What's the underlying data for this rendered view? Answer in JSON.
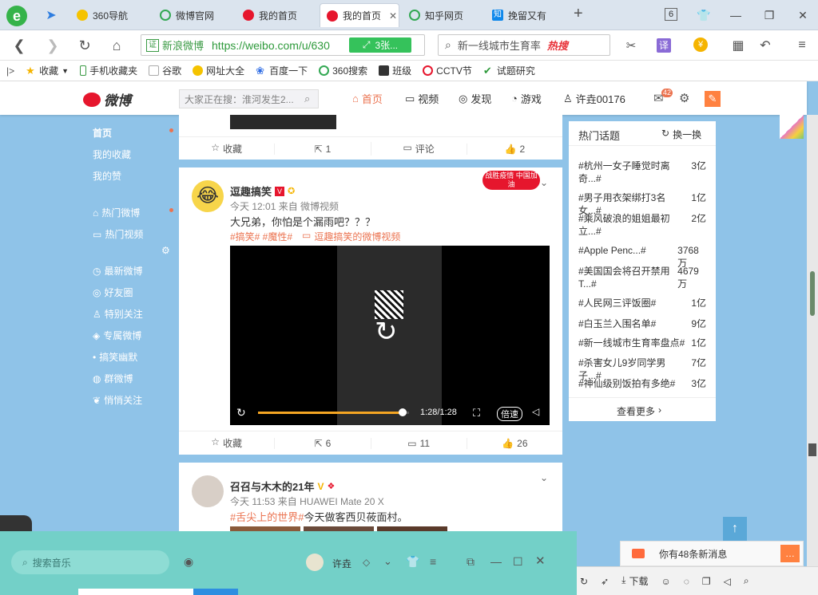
{
  "tabs": [
    {
      "label": "360导航",
      "icon": "plus-green-icon",
      "color": "#f5c300"
    },
    {
      "label": "微博官网",
      "icon": "circle-search-icon",
      "color": "#33a853"
    },
    {
      "label": "我的首页",
      "icon": "weibo-icon",
      "color": "#e6162d"
    },
    {
      "label": "我的首页",
      "icon": "weibo-icon",
      "color": "#e6162d"
    },
    {
      "label": "知乎网页",
      "icon": "circle-search-icon",
      "color": "#33a853"
    },
    {
      "label": "挽留又有",
      "icon": "zhihu-icon",
      "color": "#0f88eb"
    }
  ],
  "tab_count": "6",
  "active_tab_close": "✕",
  "new_tab": "+",
  "nav": {
    "secure_label": "新浪微博",
    "url": "https://weibo.com/u/630",
    "extension_label": "3张...",
    "search_text": "新一线城市生育率",
    "search_hot": "热搜",
    "translate": "译"
  },
  "bookmarks": [
    "收藏",
    "手机收藏夹",
    "谷歌",
    "网址大全",
    "百度一下",
    "360搜索",
    "班级",
    "CCTV节",
    "试题研究"
  ],
  "weibo": {
    "logo": "微博",
    "search_placeholder": "大家正在搜：淮河发生2...",
    "nav": [
      "首页",
      "视频",
      "发现",
      "游戏",
      "许垚00176"
    ],
    "mail_badge": "42"
  },
  "sidebar": {
    "items": [
      "首页",
      "我的收藏",
      "我的赞",
      "热门微博",
      "热门视频",
      "最新微博",
      "好友圈",
      "特别关注",
      "专属微博",
      "搞笑幽默",
      "群微博",
      "悄悄关注"
    ]
  },
  "card1": {
    "actions": [
      "收藏",
      "1",
      "评论",
      "2"
    ]
  },
  "card2": {
    "name": "逗趣搞笑",
    "badge": "战胜疫情 中国加油",
    "meta": "今天 12:01 来自 微博视频",
    "text": "大兄弟，你怕是个漏雨吧？？？",
    "tags": "#搞笑# #魔性#",
    "link": "逗趣搞笑的微博视频",
    "time": "1:28/1:28",
    "speed": "倍速",
    "actions": [
      "收藏",
      "6",
      "11",
      "26"
    ],
    "progress": 0.96
  },
  "card3": {
    "name": "召召与木木的21年",
    "meta": "今天 11:53 来自 HUAWEI Mate 20 X",
    "tag": "#舌尖上的世界#",
    "text": "今天做客西贝莜面村。"
  },
  "hot": {
    "title": "热门话题",
    "refresh": "换一换",
    "more": "查看更多",
    "rows": [
      {
        "t": "#杭州一女子睡觉时离奇...#",
        "v": "3亿"
      },
      {
        "t": "#男子用衣架绑打3名女...#",
        "v": "1亿"
      },
      {
        "t": "#乘风破浪的姐姐最初立...#",
        "v": "2亿"
      },
      {
        "t": "#Apple Penc...#",
        "v": "3768万"
      },
      {
        "t": "#美国国会将召开禁用T...#",
        "v": "4679万"
      },
      {
        "t": "#人民网三评饭圈#",
        "v": "1亿"
      },
      {
        "t": "#白玉兰入围名单#",
        "v": "9亿"
      },
      {
        "t": "#新一线城市生育率盘点#",
        "v": "1亿"
      },
      {
        "t": "#杀害女儿9岁同学男子...#",
        "v": "7亿"
      },
      {
        "t": "#神仙级别饭拍有多绝#",
        "v": "3亿"
      }
    ]
  },
  "music": {
    "search_placeholder": "搜索音乐",
    "user": "许垚"
  },
  "notify": {
    "text": "你有48条新消息"
  },
  "status": {
    "download": "下载"
  },
  "colors": {
    "accent": "#eb7350",
    "link": "#eb7350",
    "sidebar_bg": "#8fc3e8",
    "music_bg": "#73d0c8"
  }
}
